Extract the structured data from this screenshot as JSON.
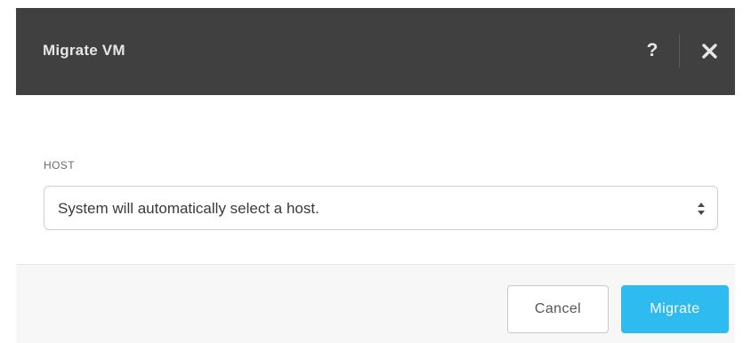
{
  "dialog": {
    "title": "Migrate VM",
    "help_icon": "question-mark-icon",
    "help_label": "?",
    "close_icon": "close-icon"
  },
  "form": {
    "host_label": "HOST",
    "host_select": {
      "selected": "System will automatically select a host.",
      "arrows_icon": "sort-arrows-icon"
    }
  },
  "footer": {
    "cancel_label": "Cancel",
    "migrate_label": "Migrate"
  },
  "colors": {
    "header_bg": "#404041",
    "primary": "#2ebcf0",
    "footer_bg": "#f7f7f8"
  }
}
